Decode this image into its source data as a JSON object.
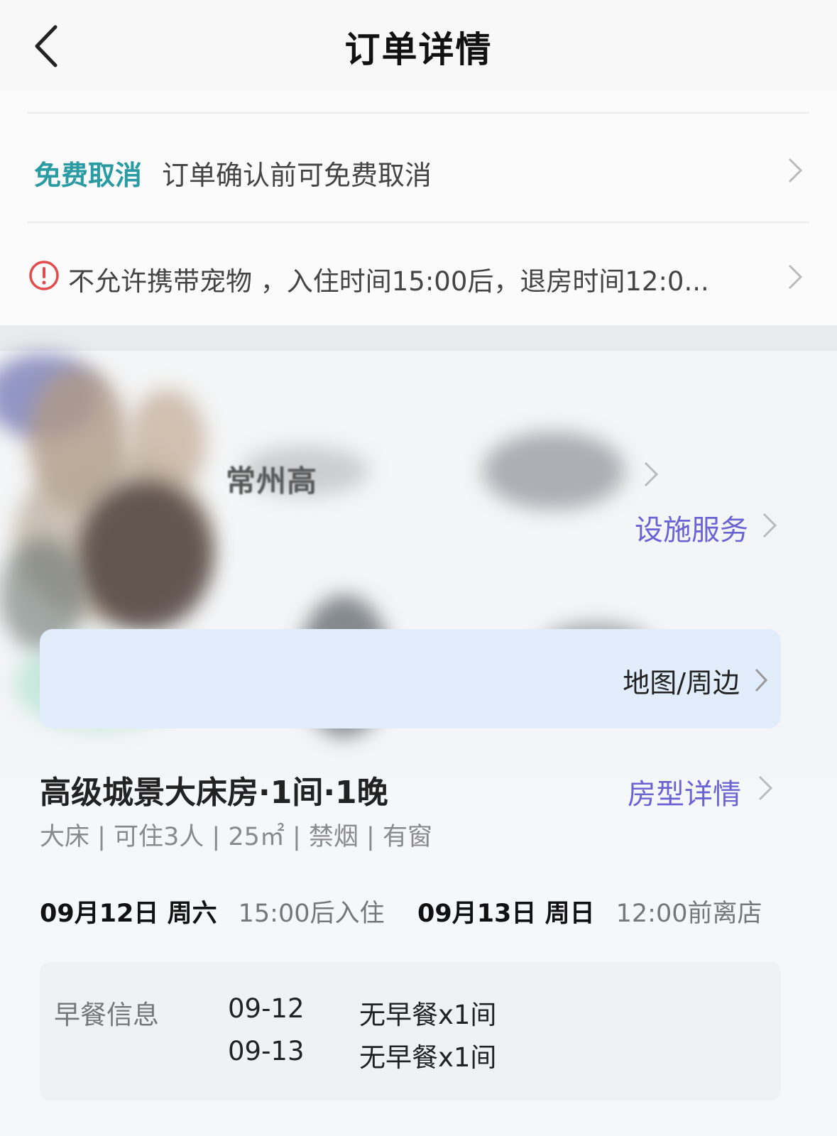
{
  "header": {
    "title": "订单详情"
  },
  "policy": {
    "free_cancel_tag": "免费取消",
    "free_cancel_text": "订单确认前可免费取消",
    "notice_text": "不允许携带宠物 ，入住时间15:00后，退房时间12:0..."
  },
  "hotel": {
    "name": "常州高",
    "facilities_link": "设施服务",
    "map_link": "地图/周边"
  },
  "room": {
    "title": "高级城景大床房·1间·1晚",
    "detail_link": "房型详情",
    "specs": "大床 | 可住3人 | 25㎡ | 禁烟 | 有窗"
  },
  "stay": {
    "checkin_date": "09月12日 周六",
    "checkin_note": "15:00后入住",
    "checkout_date": "09月13日 周日",
    "checkout_note": "12:00前离店"
  },
  "breakfast": {
    "label": "早餐信息",
    "items": [
      {
        "date": "09-12",
        "value": "无早餐x1间"
      },
      {
        "date": "09-13",
        "value": "无早餐x1间"
      }
    ]
  },
  "colors": {
    "accent_teal": "#2a9aa3",
    "link_purple": "#6b63d3",
    "warning_red": "#e34a4a"
  }
}
